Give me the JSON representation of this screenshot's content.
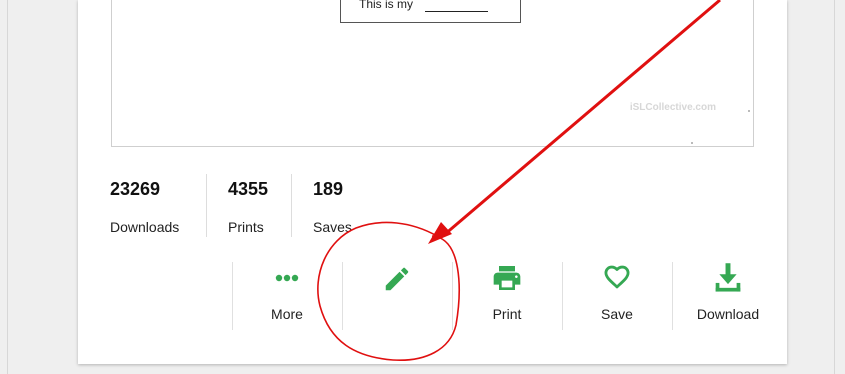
{
  "preview": {
    "worksheet_text": "This is my",
    "watermark": "iSLCollective.com"
  },
  "stats": [
    {
      "value": "23269",
      "label": "Downloads"
    },
    {
      "value": "4355",
      "label": "Prints"
    },
    {
      "value": "189",
      "label": "Saves"
    }
  ],
  "actions": {
    "more": {
      "label": "More",
      "icon": "dots-icon"
    },
    "edit": {
      "label": "",
      "icon": "pencil-icon"
    },
    "print": {
      "label": "Print",
      "icon": "printer-icon"
    },
    "save": {
      "label": "Save",
      "icon": "heart-icon"
    },
    "download": {
      "label": "Download",
      "icon": "download-icon"
    }
  },
  "colors": {
    "accent_green": "#35a853",
    "annotation_red": "#e01010",
    "background": "#efefef",
    "card": "#ffffff"
  }
}
